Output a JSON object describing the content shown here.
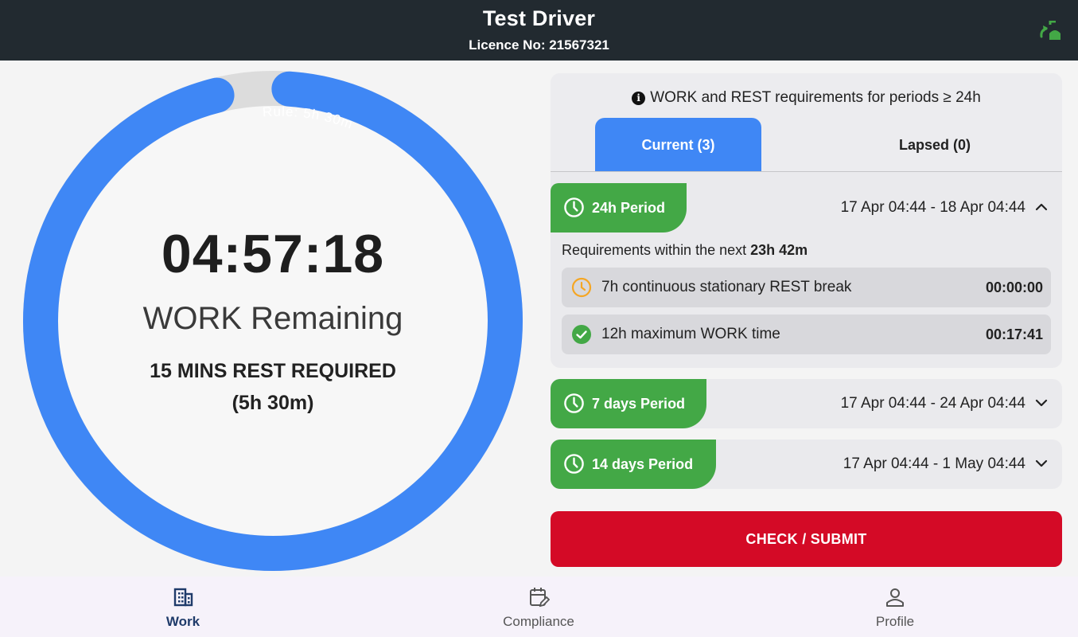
{
  "header": {
    "driver_name": "Test Driver",
    "licence": "Licence No: 21567321",
    "sync_icon": "sync-icon",
    "sync_color": "#43a846"
  },
  "gauge": {
    "rule_label": "Rule: 5h 30m",
    "time_remaining": "04:57:18",
    "work_label": "WORK Remaining",
    "rest_required": "15 MINS REST REQUIRED",
    "rest_rule": "(5h 30m)",
    "progress_fraction": 0.95,
    "ring_color": "#3f87f5",
    "track_color": "#dcdcdc"
  },
  "requirements": {
    "info_text": "WORK and REST requirements for periods ≥ 24h",
    "tabs": [
      {
        "label": "Current (3)",
        "active": true
      },
      {
        "label": "Lapsed (0)",
        "active": false
      }
    ],
    "periods": [
      {
        "label": "24h Period",
        "range": "17 Apr 04:44 - 18 Apr 04:44",
        "expanded": true,
        "within_prefix": "Requirements within the next ",
        "within_value": "23h 42m",
        "items": [
          {
            "icon": "clock-warning-icon",
            "label": "7h continuous stationary REST break",
            "value": "00:00:00",
            "status_color": "#f5a623"
          },
          {
            "icon": "check-circle-icon",
            "label": "12h maximum WORK time",
            "value": "00:17:41",
            "status_color": "#43a846"
          }
        ]
      },
      {
        "label": "7 days Period",
        "range": "17 Apr 04:44 - 24 Apr 04:44",
        "expanded": false
      },
      {
        "label": "14 days Period",
        "range": "17 Apr 04:44 - 1 May 04:44",
        "expanded": false
      }
    ],
    "period_color": "#43a846"
  },
  "submit": {
    "label": "CHECK / SUBMIT",
    "color": "#d40a26"
  },
  "nav": {
    "items": [
      {
        "label": "Work",
        "icon": "building-icon",
        "active": true
      },
      {
        "label": "Compliance",
        "icon": "calendar-edit-icon",
        "active": false
      },
      {
        "label": "Profile",
        "icon": "person-icon",
        "active": false
      }
    ]
  }
}
